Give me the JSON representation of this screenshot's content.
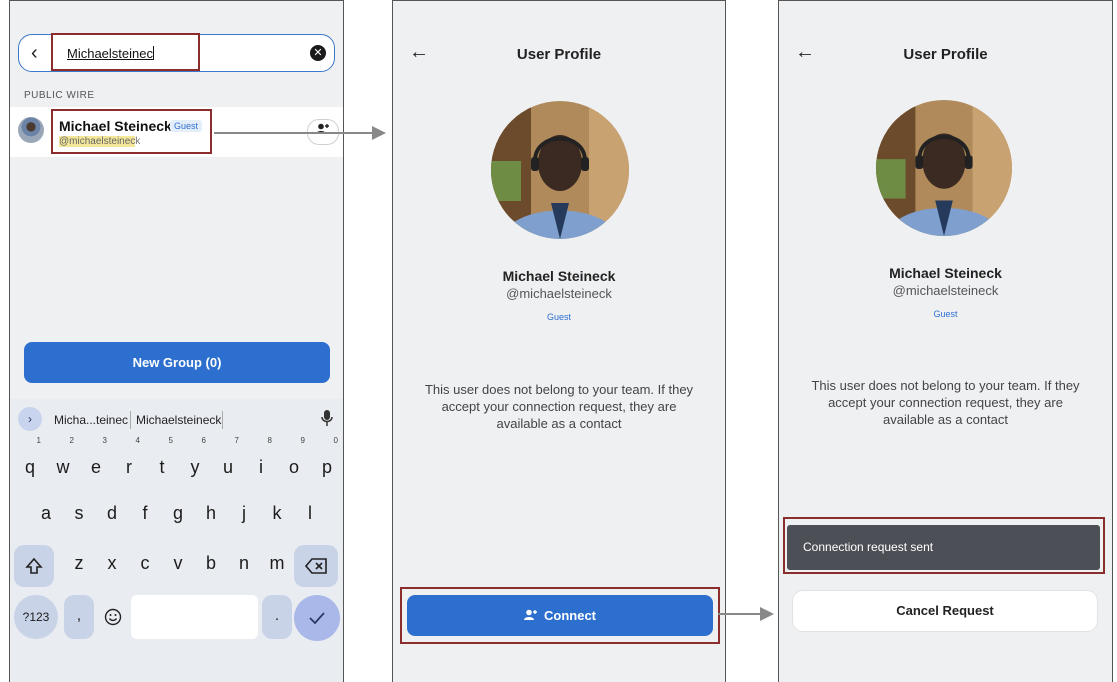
{
  "search_screen": {
    "query": "Michaelsteinec",
    "section_label": "PUBLIC WIRE",
    "result": {
      "name": "Michael Steineck",
      "badge": "Guest",
      "handle_match": "@michaelsteinec",
      "handle_rest": "k"
    },
    "new_group_label": "New Group (0)",
    "keyboard": {
      "suggestions": [
        "Micha...teinec",
        "Michaelsteineck"
      ],
      "row1": [
        "q",
        "w",
        "e",
        "r",
        "t",
        "y",
        "u",
        "i",
        "o",
        "p"
      ],
      "row1_hints": [
        "1",
        "2",
        "3",
        "4",
        "5",
        "6",
        "7",
        "8",
        "9",
        "0"
      ],
      "row2": [
        "a",
        "s",
        "d",
        "f",
        "g",
        "h",
        "j",
        "k",
        "l"
      ],
      "row3": [
        "z",
        "x",
        "c",
        "v",
        "b",
        "n",
        "m"
      ],
      "symbols_label": "?123",
      "comma_label": ",",
      "period_label": "."
    }
  },
  "profile_before": {
    "title": "User Profile",
    "name": "Michael Steineck",
    "handle": "@michaelsteineck",
    "badge": "Guest",
    "description": "This user does not belong to your team. If they accept your connection request, they are available as a contact",
    "connect_label": "Connect"
  },
  "profile_after": {
    "title": "User Profile",
    "name": "Michael Steineck",
    "handle": "@michaelsteineck",
    "badge": "Guest",
    "description": "This user does not belong to your team. If they accept your connection request, they are available as a contact",
    "toast": "Connection request sent",
    "cancel_label": "Cancel Request"
  },
  "colors": {
    "primary": "#2d6fce",
    "highlight_box": "#8c2d2d",
    "screen_bg": "#eff0f2",
    "toast_bg": "#4c4f55"
  }
}
